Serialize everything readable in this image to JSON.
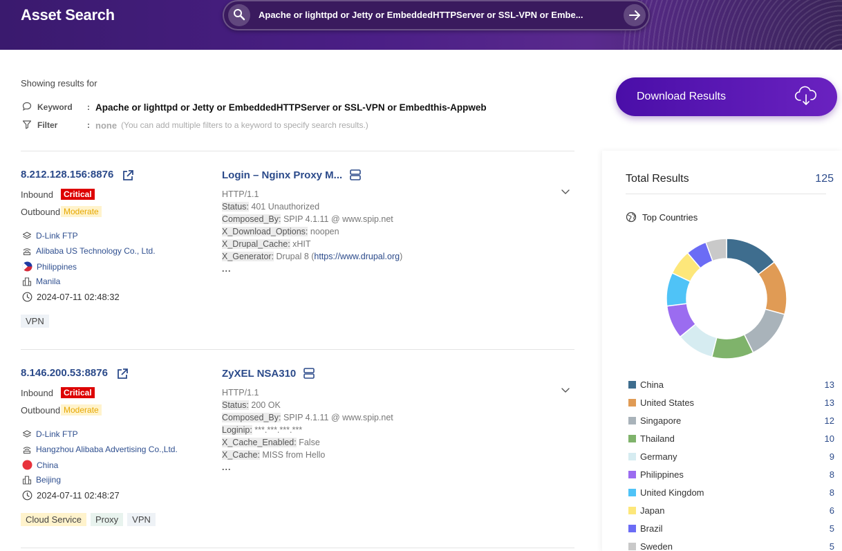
{
  "header": {
    "title": "Asset Search",
    "search_query": "Apache or lighttpd or Jetty or EmbeddedHTTPServer or SSL-VPN or Embe..."
  },
  "summary": {
    "showing_label": "Showing results for",
    "keyword_label": "Keyword",
    "keyword_value": "Apache or lighttpd or Jetty or EmbeddedHTTPServer or SSL-VPN or Embedthis-Appweb",
    "filter_label": "Filter",
    "filter_value": "none",
    "filter_hint": "(You can add multiple filters to a keyword to specify search results.)",
    "colon": ":"
  },
  "download": {
    "label": "Download Results"
  },
  "results": [
    {
      "ip": "8.212.128.156:8876",
      "inbound_label": "Inbound",
      "inbound_level": "Critical",
      "outbound_label": "Outbound",
      "outbound_level": "Moderate",
      "product": "D-Link FTP",
      "org": "Alibaba US Technology Co., Ltd.",
      "country": "Philippines",
      "city": "Manila",
      "timestamp": "2024-07-11 02:48:32",
      "tags": [
        "VPN"
      ],
      "service_title": "Login – Nginx Proxy M...",
      "protocol": "HTTP/1.1",
      "headers": [
        {
          "key": "Status:",
          "value": " 401 Unauthorized"
        },
        {
          "key": "Composed_By:",
          "value": " SPIP 4.1.11 @ www.spip.net"
        },
        {
          "key": "X_Download_Options:",
          "value": " noopen"
        },
        {
          "key": "X_Drupal_Cache:",
          "value": " xHIT"
        },
        {
          "key": "X_Generator:",
          "value": " Drupal 8 (",
          "link": "https://www.drupal.org",
          "suffix": ")"
        }
      ],
      "more": "..."
    },
    {
      "ip": "8.146.200.53:8876",
      "inbound_label": "Inbound",
      "inbound_level": "Critical",
      "outbound_label": "Outbound",
      "outbound_level": "Moderate",
      "product": "D-Link FTP",
      "org": "Hangzhou Alibaba Advertising Co.,Ltd.",
      "country": "China",
      "city": "Beijing",
      "timestamp": "2024-07-11 02:48:27",
      "tags": [
        "Cloud Service",
        "Proxy",
        "VPN"
      ],
      "service_title": "ZyXEL NSA310",
      "protocol": "HTTP/1.1",
      "headers": [
        {
          "key": "Status:",
          "value": " 200 OK"
        },
        {
          "key": "Composed_By:",
          "value": " SPIP 4.1.11 @ www.spip.net"
        },
        {
          "key": "Loginip:",
          "value": " ***.***.***.***"
        },
        {
          "key": "X_Cache_Enabled:",
          "value": " False"
        },
        {
          "key": "X_Cache:",
          "value": " MISS from Hello"
        }
      ],
      "more": "..."
    }
  ],
  "stats": {
    "total_label": "Total Results",
    "total_value": "125",
    "top_countries_label": "Top Countries",
    "countries": [
      {
        "name": "China",
        "count": 13,
        "color": "#3e6d8e"
      },
      {
        "name": "United States",
        "count": 13,
        "color": "#e09b55"
      },
      {
        "name": "Singapore",
        "count": 12,
        "color": "#a9b3ba"
      },
      {
        "name": "Thailand",
        "count": 10,
        "color": "#7fb36b"
      },
      {
        "name": "Germany",
        "count": 9,
        "color": "#d6ecf1"
      },
      {
        "name": "Philippines",
        "count": 8,
        "color": "#9b6cf0"
      },
      {
        "name": "United Kingdom",
        "count": 8,
        "color": "#4fc3f7"
      },
      {
        "name": "Japan",
        "count": 6,
        "color": "#fde77a"
      },
      {
        "name": "Brazil",
        "count": 5,
        "color": "#6b6cf5"
      },
      {
        "name": "Sweden",
        "count": 5,
        "color": "#c9c9c9"
      }
    ]
  },
  "chart_data": {
    "type": "pie",
    "categories": [
      "China",
      "United States",
      "Singapore",
      "Thailand",
      "Germany",
      "Philippines",
      "United Kingdom",
      "Japan",
      "Brazil",
      "Sweden"
    ],
    "values": [
      13,
      13,
      12,
      10,
      9,
      8,
      8,
      6,
      5,
      5
    ],
    "title": "Top Countries",
    "legend": "bottom"
  }
}
